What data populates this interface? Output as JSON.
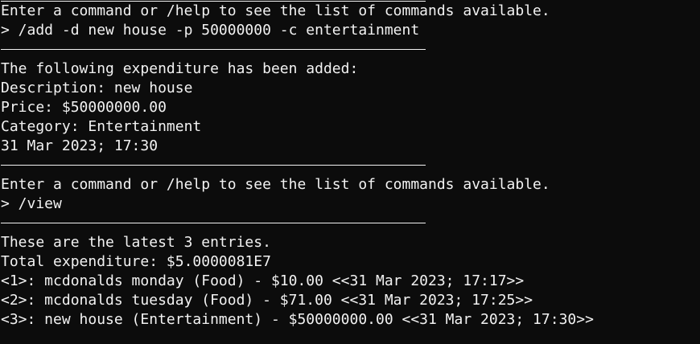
{
  "terminal": {
    "block1": {
      "prompt_text": "Enter a command or /help to see the list of commands available.",
      "command": "> /add -d new house -p 50000000 -c entertainment"
    },
    "add_result": {
      "header": "The following expenditure has been added:",
      "description": "Description: new house",
      "price": "Price: $50000000.00",
      "category": "Category: Entertainment",
      "datetime": "31 Mar 2023; 17:30"
    },
    "block2": {
      "prompt_text": "Enter a command or /help to see the list of commands available.",
      "command": "> /view"
    },
    "view_result": {
      "header": "These are the latest 3 entries.",
      "total": "Total expenditure: $5.0000081E7",
      "entries": [
        "<1>: mcdonalds monday (Food) - $10.00 <<31 Mar 2023; 17:17>>",
        "<2>: mcdonalds tuesday (Food) - $71.00 <<31 Mar 2023; 17:25>>",
        "<3>: new house (Entertainment) - $50000000.00 <<31 Mar 2023; 17:30>>"
      ]
    }
  }
}
